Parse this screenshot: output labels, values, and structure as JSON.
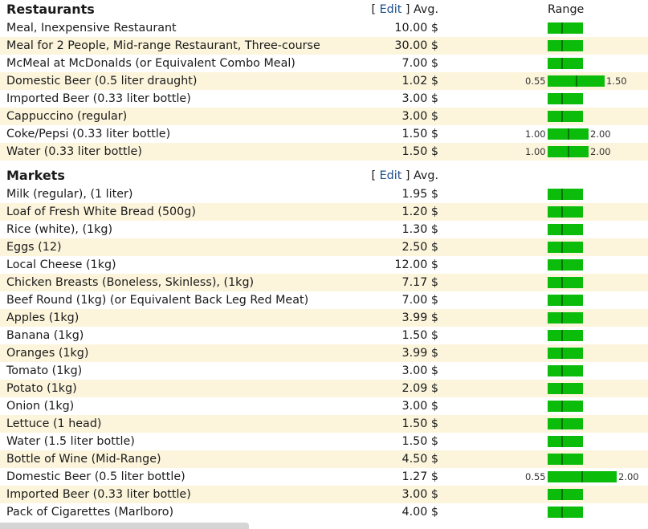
{
  "sections": [
    {
      "title": "Restaurants",
      "edit_label": "Edit",
      "avg_label": "Avg.",
      "range_label": "Range",
      "items": [
        {
          "name": "Meal, Inexpensive Restaurant",
          "price": "10.00 $",
          "bar": [
            0.2,
            0.6
          ],
          "mark": 0.4
        },
        {
          "name": "Meal for 2 People, Mid-range Restaurant, Three-course",
          "price": "30.00 $",
          "bar": [
            0.2,
            0.6
          ],
          "mark": 0.4
        },
        {
          "name": "McMeal at McDonalds (or Equivalent Combo Meal)",
          "price": "7.00 $",
          "bar": [
            0.2,
            0.6
          ],
          "mark": 0.4
        },
        {
          "name": "Domestic Beer (0.5 liter draught)",
          "price": "1.02 $",
          "min": "0.55",
          "max": "1.50",
          "bar": [
            0.2,
            0.6
          ],
          "mark": 0.5
        },
        {
          "name": "Imported Beer (0.33 liter bottle)",
          "price": "3.00 $",
          "bar": [
            0.2,
            0.6
          ],
          "mark": 0.4
        },
        {
          "name": "Cappuccino (regular)",
          "price": "3.00 $",
          "bar": [
            0.2,
            0.6
          ],
          "mark": 0.4
        },
        {
          "name": "Coke/Pepsi (0.33 liter bottle)",
          "price": "1.50 $",
          "min": "1.00",
          "max": "2.00",
          "bar": [
            0.2,
            0.6
          ],
          "mark": 0.5
        },
        {
          "name": "Water (0.33 liter bottle)",
          "price": "1.50 $",
          "min": "1.00",
          "max": "2.00",
          "bar": [
            0.2,
            0.6
          ],
          "mark": 0.5
        }
      ]
    },
    {
      "title": "Markets",
      "edit_label": "Edit",
      "avg_label": "Avg.",
      "items": [
        {
          "name": "Milk (regular), (1 liter)",
          "price": "1.95 $",
          "bar": [
            0.2,
            0.6
          ],
          "mark": 0.4
        },
        {
          "name": "Loaf of Fresh White Bread (500g)",
          "price": "1.20 $",
          "bar": [
            0.2,
            0.6
          ],
          "mark": 0.4
        },
        {
          "name": "Rice (white), (1kg)",
          "price": "1.30 $",
          "bar": [
            0.2,
            0.6
          ],
          "mark": 0.4
        },
        {
          "name": "Eggs (12)",
          "price": "2.50 $",
          "bar": [
            0.2,
            0.6
          ],
          "mark": 0.4
        },
        {
          "name": "Local Cheese (1kg)",
          "price": "12.00 $",
          "bar": [
            0.2,
            0.6
          ],
          "mark": 0.4
        },
        {
          "name": "Chicken Breasts (Boneless, Skinless), (1kg)",
          "price": "7.17 $",
          "bar": [
            0.2,
            0.6
          ],
          "mark": 0.4
        },
        {
          "name": "Beef Round (1kg) (or Equivalent Back Leg Red Meat)",
          "price": "7.00 $",
          "bar": [
            0.2,
            0.6
          ],
          "mark": 0.4
        },
        {
          "name": "Apples (1kg)",
          "price": "3.99 $",
          "bar": [
            0.2,
            0.6
          ],
          "mark": 0.4
        },
        {
          "name": "Banana (1kg)",
          "price": "1.50 $",
          "bar": [
            0.2,
            0.6
          ],
          "mark": 0.4
        },
        {
          "name": "Oranges (1kg)",
          "price": "3.99 $",
          "bar": [
            0.2,
            0.6
          ],
          "mark": 0.4
        },
        {
          "name": "Tomato (1kg)",
          "price": "3.00 $",
          "bar": [
            0.2,
            0.6
          ],
          "mark": 0.4
        },
        {
          "name": "Potato (1kg)",
          "price": "2.09 $",
          "bar": [
            0.2,
            0.6
          ],
          "mark": 0.4
        },
        {
          "name": "Onion (1kg)",
          "price": "3.00 $",
          "bar": [
            0.2,
            0.6
          ],
          "mark": 0.4
        },
        {
          "name": "Lettuce (1 head)",
          "price": "1.50 $",
          "bar": [
            0.2,
            0.6
          ],
          "mark": 0.4
        },
        {
          "name": "Water (1.5 liter bottle)",
          "price": "1.50 $",
          "bar": [
            0.2,
            0.6
          ],
          "mark": 0.4
        },
        {
          "name": "Bottle of Wine (Mid-Range)",
          "price": "4.50 $",
          "bar": [
            0.2,
            0.6
          ],
          "mark": 0.4
        },
        {
          "name": "Domestic Beer (0.5 liter bottle)",
          "price": "1.27 $",
          "min": "0.55",
          "max": "2.00",
          "bar": [
            0.2,
            0.6
          ],
          "mark": 0.5
        },
        {
          "name": "Imported Beer (0.33 liter bottle)",
          "price": "3.00 $",
          "bar": [
            0.2,
            0.6
          ],
          "mark": 0.4
        },
        {
          "name": "Pack of Cigarettes (Marlboro)",
          "price": "4.00 $",
          "bar": [
            0.2,
            0.6
          ],
          "mark": 0.4
        }
      ]
    }
  ],
  "colors": {
    "bar": "#0bbc0b",
    "mark": "#027502",
    "row_alt": "#fcf5dc",
    "link": "#1a4e8a"
  }
}
